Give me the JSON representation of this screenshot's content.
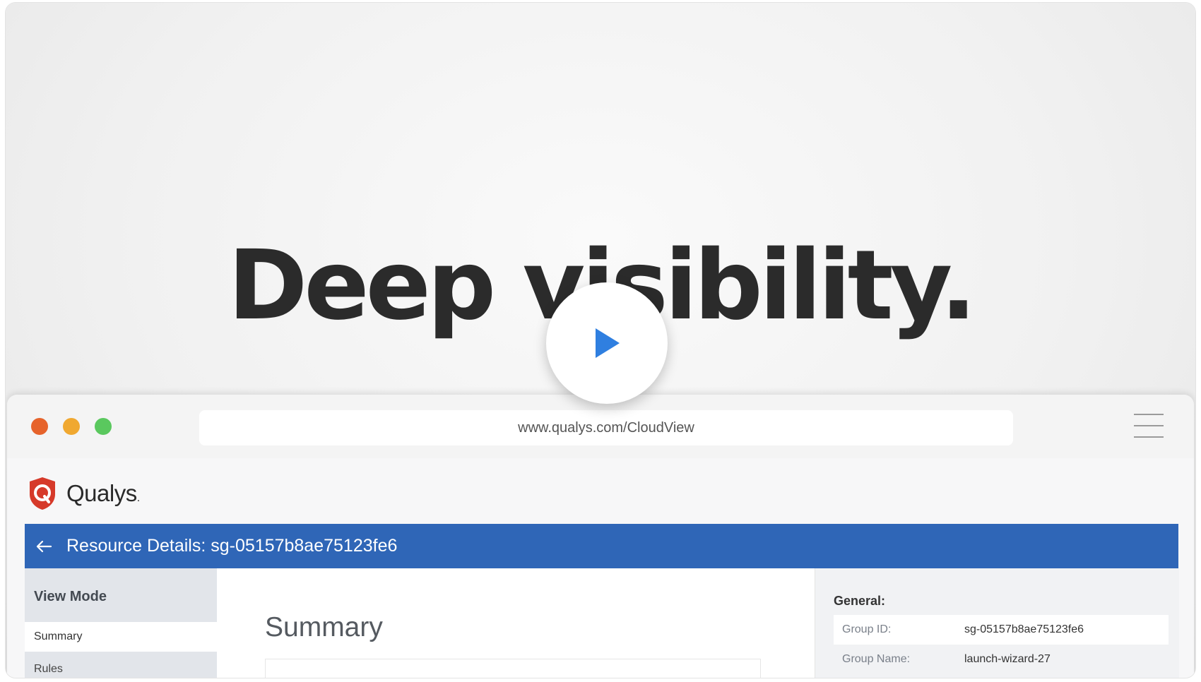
{
  "hero": {
    "headline": "Deep visibility."
  },
  "browser": {
    "url": "www.qualys.com/CloudView",
    "traffic_lights": {
      "close": "#e6632b",
      "minimize": "#f0a830",
      "zoom": "#5ac85e"
    }
  },
  "app": {
    "logo": {
      "name": "Qualys",
      "dot": ".",
      "color": "#d63a2a"
    },
    "header": {
      "title": "Resource Details: sg-05157b8ae75123fe6",
      "color": "#2f66b7"
    },
    "sidebar": {
      "heading": "View Mode",
      "items": [
        {
          "label": "Summary",
          "active": true
        },
        {
          "label": "Rules",
          "active": false
        }
      ]
    },
    "main": {
      "title": "Summary"
    },
    "details": {
      "heading": "General:",
      "rows": [
        {
          "label": "Group ID:",
          "value": "sg-05157b8ae75123fe6"
        },
        {
          "label": "Group Name:",
          "value": "launch-wizard-27"
        }
      ]
    }
  },
  "player": {
    "play_icon": "play-icon",
    "accent": "#2f7fe0"
  }
}
